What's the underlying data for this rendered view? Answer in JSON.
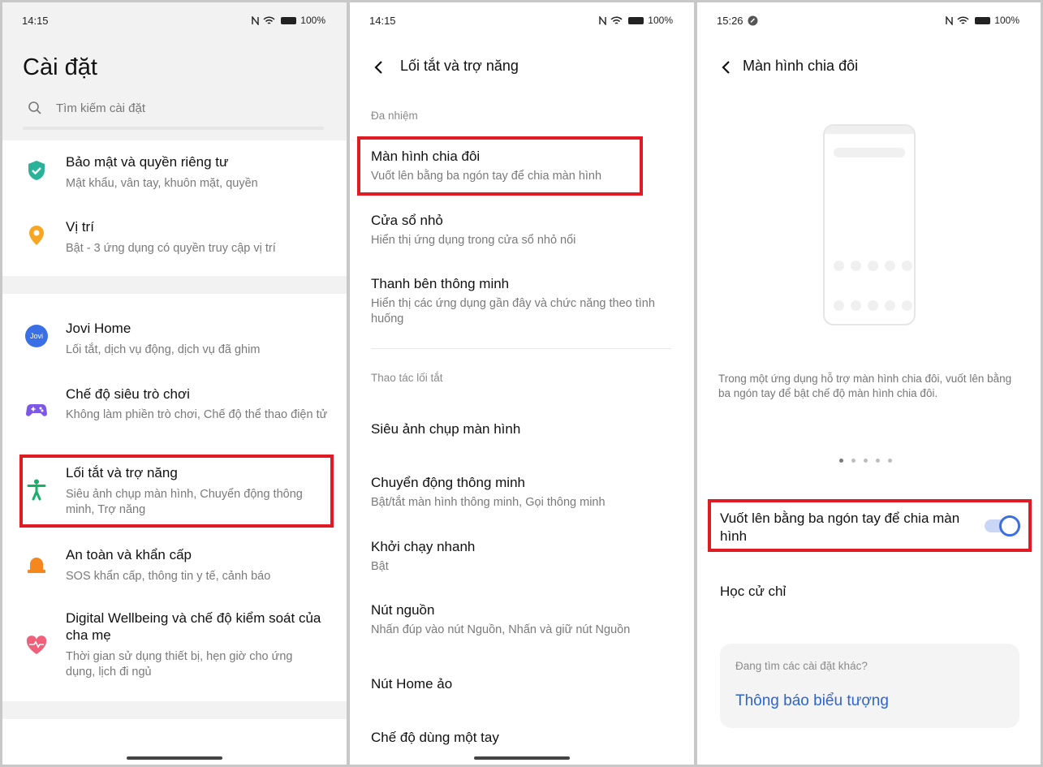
{
  "status": {
    "p1_time": "14:15",
    "p2_time": "14:15",
    "p3_time": "15:26",
    "battery": "100%"
  },
  "settings": {
    "title": "Cài đặt",
    "search_placeholder": "Tìm kiếm cài đặt",
    "items": [
      {
        "title": "Bảo mật và quyền riêng tư",
        "subtitle": "Mật khẩu, vân tay, khuôn mặt, quyền"
      },
      {
        "title": "Vị trí",
        "subtitle": "Bật - 3 ứng dụng có quyền truy cập vị trí"
      },
      {
        "title": "Jovi Home",
        "subtitle": "Lối tắt, dịch vụ động, dịch vụ đã ghim",
        "icon_text": "Jovi"
      },
      {
        "title": "Chế độ siêu trò chơi",
        "subtitle": "Không làm phiền trò chơi, Chế độ thể thao điện tử"
      },
      {
        "title": "Lối tắt và trợ năng",
        "subtitle": "Siêu ảnh chụp màn hình, Chuyển động thông minh, Trợ năng"
      },
      {
        "title": "An toàn và khẩn cấp",
        "subtitle": "SOS khẩn cấp, thông tin y tế, cảnh báo"
      },
      {
        "title": "Digital Wellbeing và chế độ kiểm soát của cha mẹ",
        "subtitle": "Thời gian sử dụng thiết bị, hẹn giờ cho ứng dụng, lịch đi ngủ"
      }
    ]
  },
  "shortcuts": {
    "title": "Lối tắt và trợ năng",
    "section_multitask": "Đa nhiệm",
    "section_shortcut_ops": "Thao tác lối tắt",
    "items": [
      {
        "title": "Màn hình chia đôi",
        "subtitle": "Vuốt lên bằng ba ngón tay để chia màn hình"
      },
      {
        "title": "Cửa sổ nhỏ",
        "subtitle": "Hiển thị ứng dụng trong cửa sổ nhỏ nổi"
      },
      {
        "title": "Thanh bên thông minh",
        "subtitle": "Hiển thị các ứng dụng gần đây và chức năng theo tình huống"
      },
      {
        "title": "Siêu ảnh chụp màn hình"
      },
      {
        "title": "Chuyển động thông minh",
        "subtitle": "Bật/tắt màn hình thông minh, Gọi thông minh"
      },
      {
        "title": "Khởi chạy nhanh",
        "subtitle": "Bật"
      },
      {
        "title": "Nút nguồn",
        "subtitle": "Nhấn đúp vào nút Nguồn, Nhấn và giữ nút Nguồn"
      },
      {
        "title": "Nút Home ảo"
      },
      {
        "title": "Chế độ dùng một tay"
      }
    ]
  },
  "split_screen": {
    "title": "Màn hình chia đôi",
    "description": "Trong một ứng dụng hỗ trợ màn hình chia đôi, vuốt lên bằng ba ngón tay để bật chế độ màn hình chia đôi.",
    "toggle_label": "Vuốt lên bằng ba ngón tay để chia màn hình",
    "toggle_on": true,
    "learn_gestures": "Học cử chỉ",
    "more_prompt": "Đang tìm các cài đặt khác?",
    "more_link": "Thông báo biểu tượng",
    "pager_pages": 5,
    "pager_active": 1
  },
  "colors": {
    "highlight": "#e01b24",
    "accent": "#3d6fe0",
    "link": "#2d64d4"
  }
}
